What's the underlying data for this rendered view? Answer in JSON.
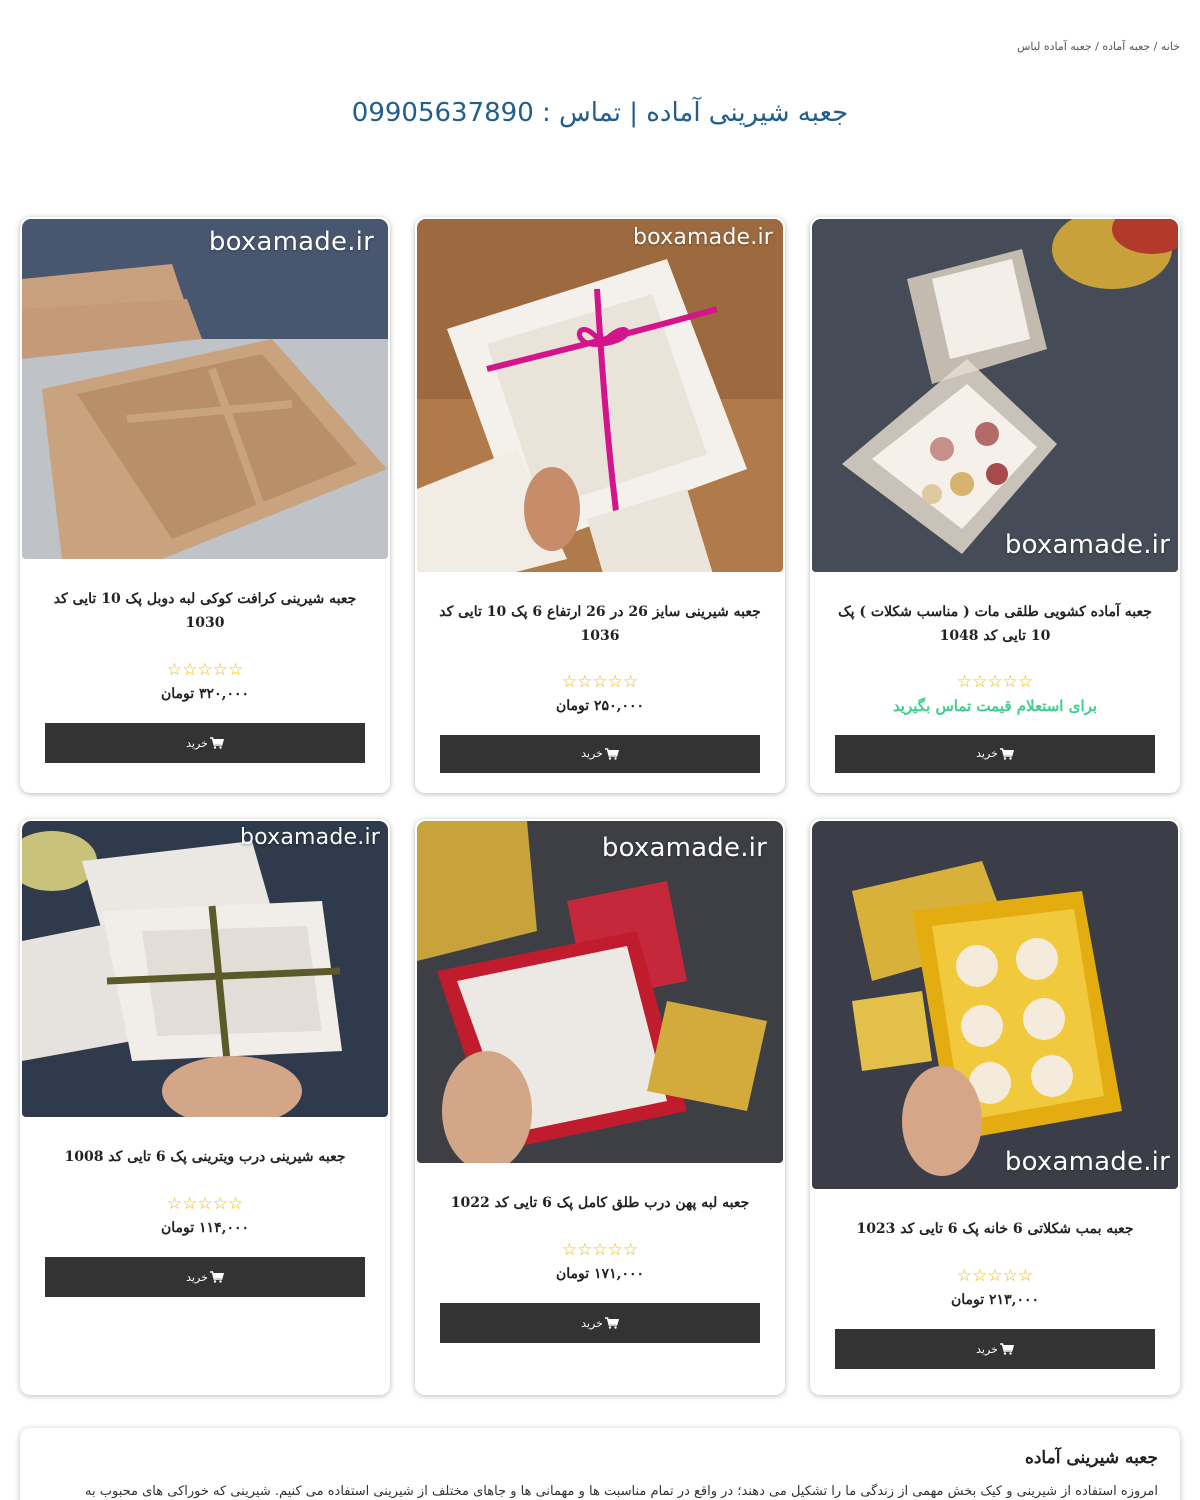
{
  "breadcrumb": {
    "home": "خانه",
    "separator1": " / ",
    "category": "جعبه آماده",
    "separator2": " / ",
    "current": "جعبه آماده لباس"
  },
  "page_title": "جعبه شیرینی آماده | تماس : 09905637890",
  "watermark": "boxamade.ir",
  "products": [
    {
      "title": "جعبه آماده کشویی طلقی مات ( مناسب شکلات ) پک 10 تایی کد 1048",
      "stars": "☆☆☆☆☆",
      "price": "",
      "price_note": "برای استعلام قیمت تماس بگیرید",
      "button": "خرید"
    },
    {
      "title": "جعبه شیرینی سایز 26 در 26 ارتفاع 6 پک 10 تایی کد 1036",
      "stars": "☆☆☆☆☆",
      "price": "۲۵۰,۰۰۰ تومان",
      "price_note": "",
      "button": "خرید"
    },
    {
      "title": "جعبه شیرینی کرافت کوکی لبه دوبل پک 10 تایی کد 1030",
      "stars": "☆☆☆☆☆",
      "price": "۳۲۰,۰۰۰ تومان",
      "price_note": "",
      "button": "خرید"
    },
    {
      "title": "جعبه بمب شکلاتی 6 خانه پک 6 تایی کد 1023",
      "stars": "☆☆☆☆☆",
      "price": "۲۱۳,۰۰۰ تومان",
      "price_note": "",
      "button": "خرید"
    },
    {
      "title": "جعبه لبه پهن درب طلق کامل پک 6 تایی کد 1022",
      "stars": "☆☆☆☆☆",
      "price": "۱۷۱,۰۰۰ تومان",
      "price_note": "",
      "button": "خرید"
    },
    {
      "title": "جعبه شیرینی درب ویترینی پک 6 تایی کد 1008",
      "stars": "☆☆☆☆☆",
      "price": "۱۱۴,۰۰۰ تومان",
      "price_note": "",
      "button": "خرید"
    }
  ],
  "description": {
    "title": "جعبه شیرینی آماده",
    "text": "امروزه استفاده از شیرینی و کیک بخش مهمی از زندگی ما را تشکیل می دهند؛ در واقع در تمام مناسبت ها و مهمانی ها و جاهای مختلف از شیرینی استفاده می کنیم. شیرینی که خوراکی های محبوب به"
  },
  "colors": {
    "title_blue": "#1f5e8f",
    "button_dark": "#333333",
    "star_gold": "#f0b400",
    "contact_green": "#3ccf8e"
  },
  "icons": {
    "rating": "star-outline-icon",
    "cart": "cart-icon"
  }
}
